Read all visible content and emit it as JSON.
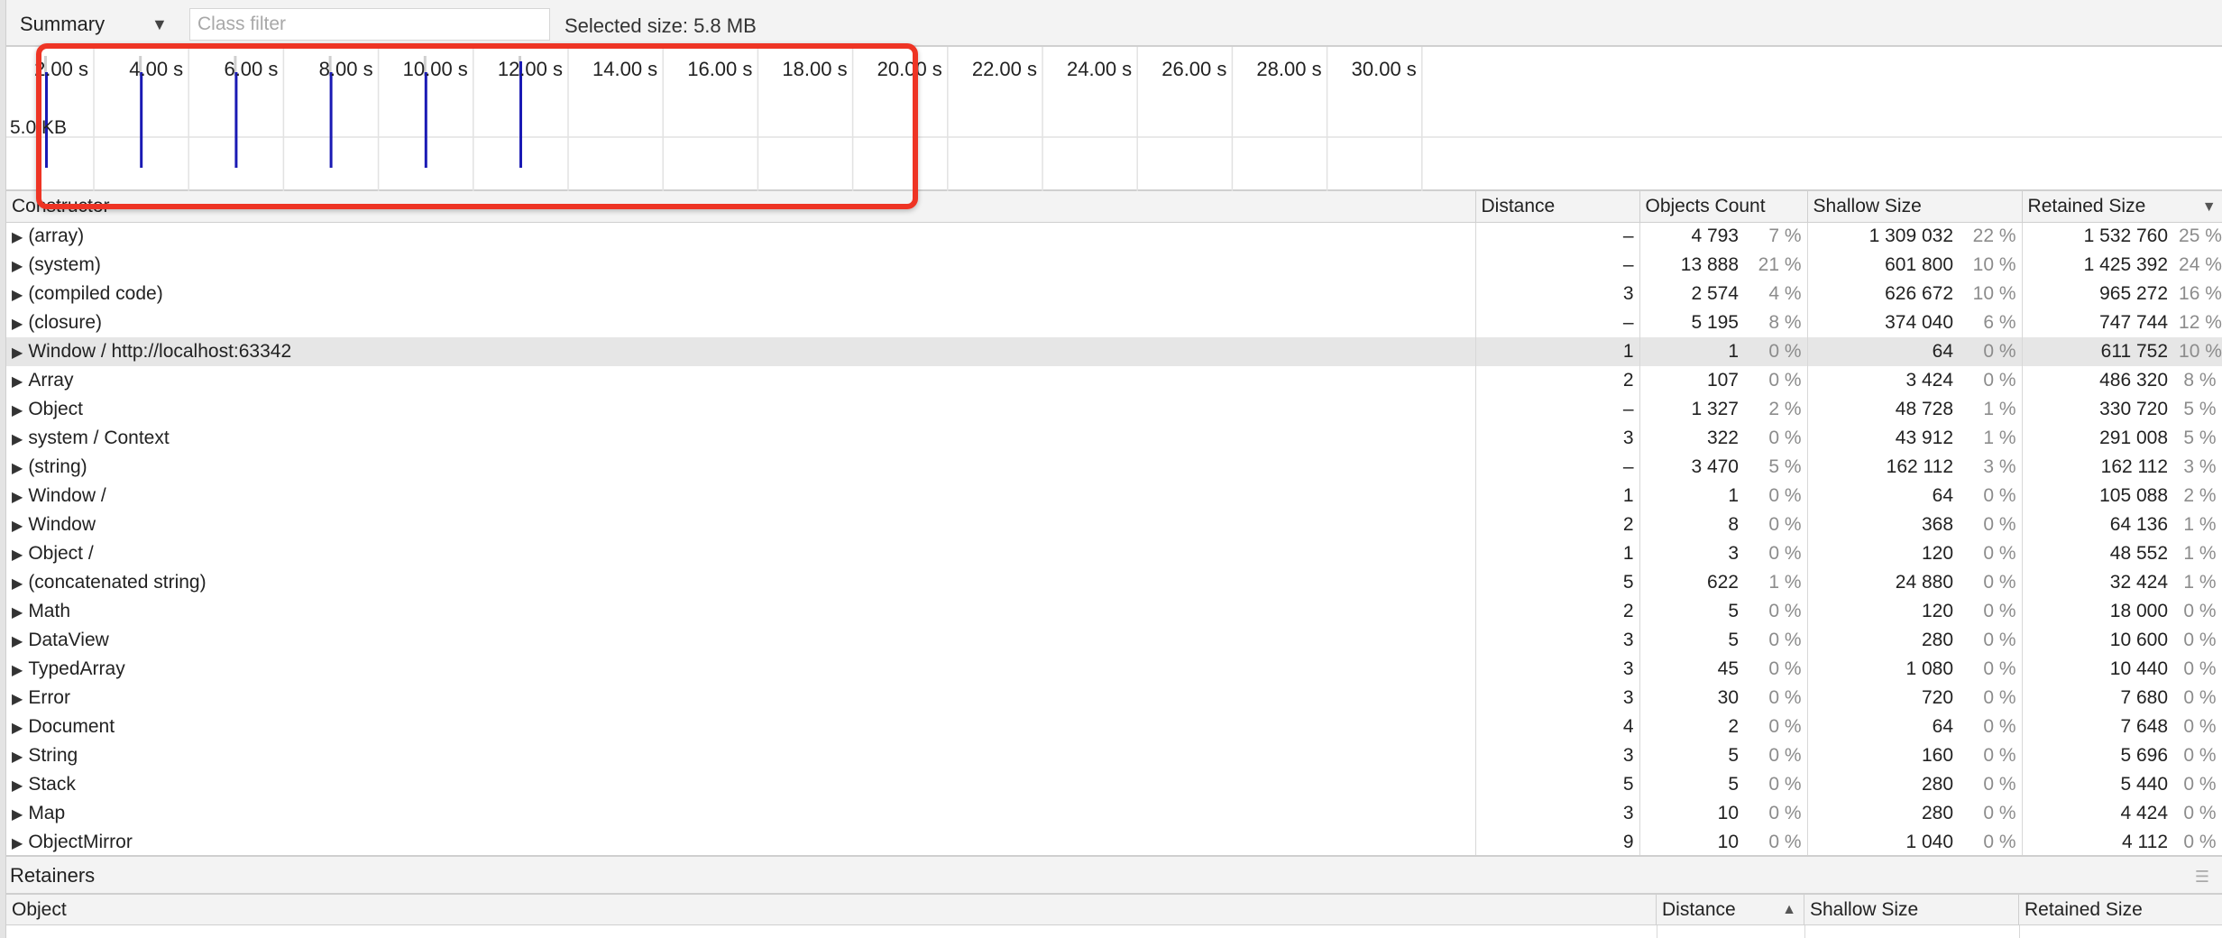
{
  "toolbar": {
    "view_select": "Summary",
    "class_filter_placeholder": "Class filter",
    "selected_size": "Selected size: 5.8 MB"
  },
  "timeline": {
    "ticks": [
      "2.00 s",
      "4.00 s",
      "6.00 s",
      "8.00 s",
      "10.00 s",
      "12.00 s",
      "14.00 s",
      "16.00 s",
      "18.00 s",
      "20.00 s",
      "22.00 s",
      "24.00 s",
      "26.00 s",
      "28.00 s",
      "30.00 s"
    ],
    "y_label": "5.0 KB",
    "bar_color": "#1a1ab4",
    "highlight_color": "#ee3424"
  },
  "table": {
    "headers": {
      "constructor": "Constructor",
      "distance": "Distance",
      "objects_count": "Objects Count",
      "shallow_size": "Shallow Size",
      "retained_size": "Retained Size"
    },
    "rows": [
      {
        "name": "(array)",
        "distance": "–",
        "count": "4 793",
        "count_pct": "7 %",
        "shallow": "1 309 032",
        "shallow_pct": "22 %",
        "retained": "1 532 760",
        "retained_pct": "25 %"
      },
      {
        "name": "(system)",
        "distance": "–",
        "count": "13 888",
        "count_pct": "21 %",
        "shallow": "601 800",
        "shallow_pct": "10 %",
        "retained": "1 425 392",
        "retained_pct": "24 %"
      },
      {
        "name": "(compiled code)",
        "distance": "3",
        "count": "2 574",
        "count_pct": "4 %",
        "shallow": "626 672",
        "shallow_pct": "10 %",
        "retained": "965 272",
        "retained_pct": "16 %"
      },
      {
        "name": "(closure)",
        "distance": "–",
        "count": "5 195",
        "count_pct": "8 %",
        "shallow": "374 040",
        "shallow_pct": "6 %",
        "retained": "747 744",
        "retained_pct": "12 %"
      },
      {
        "name": "Window / http://localhost:63342",
        "distance": "1",
        "count": "1",
        "count_pct": "0 %",
        "shallow": "64",
        "shallow_pct": "0 %",
        "retained": "611 752",
        "retained_pct": "10 %"
      },
      {
        "name": "Array",
        "distance": "2",
        "count": "107",
        "count_pct": "0 %",
        "shallow": "3 424",
        "shallow_pct": "0 %",
        "retained": "486 320",
        "retained_pct": "8 %"
      },
      {
        "name": "Object",
        "distance": "–",
        "count": "1 327",
        "count_pct": "2 %",
        "shallow": "48 728",
        "shallow_pct": "1 %",
        "retained": "330 720",
        "retained_pct": "5 %"
      },
      {
        "name": "system / Context",
        "distance": "3",
        "count": "322",
        "count_pct": "0 %",
        "shallow": "43 912",
        "shallow_pct": "1 %",
        "retained": "291 008",
        "retained_pct": "5 %"
      },
      {
        "name": "(string)",
        "distance": "–",
        "count": "3 470",
        "count_pct": "5 %",
        "shallow": "162 112",
        "shallow_pct": "3 %",
        "retained": "162 112",
        "retained_pct": "3 %"
      },
      {
        "name": "Window /",
        "distance": "1",
        "count": "1",
        "count_pct": "0 %",
        "shallow": "64",
        "shallow_pct": "0 %",
        "retained": "105 088",
        "retained_pct": "2 %"
      },
      {
        "name": "Window",
        "distance": "2",
        "count": "8",
        "count_pct": "0 %",
        "shallow": "368",
        "shallow_pct": "0 %",
        "retained": "64 136",
        "retained_pct": "1 %"
      },
      {
        "name": "Object /",
        "distance": "1",
        "count": "3",
        "count_pct": "0 %",
        "shallow": "120",
        "shallow_pct": "0 %",
        "retained": "48 552",
        "retained_pct": "1 %"
      },
      {
        "name": "(concatenated string)",
        "distance": "5",
        "count": "622",
        "count_pct": "1 %",
        "shallow": "24 880",
        "shallow_pct": "0 %",
        "retained": "32 424",
        "retained_pct": "1 %"
      },
      {
        "name": "Math",
        "distance": "2",
        "count": "5",
        "count_pct": "0 %",
        "shallow": "120",
        "shallow_pct": "0 %",
        "retained": "18 000",
        "retained_pct": "0 %"
      },
      {
        "name": "DataView",
        "distance": "3",
        "count": "5",
        "count_pct": "0 %",
        "shallow": "280",
        "shallow_pct": "0 %",
        "retained": "10 600",
        "retained_pct": "0 %"
      },
      {
        "name": "TypedArray",
        "distance": "3",
        "count": "45",
        "count_pct": "0 %",
        "shallow": "1 080",
        "shallow_pct": "0 %",
        "retained": "10 440",
        "retained_pct": "0 %"
      },
      {
        "name": "Error",
        "distance": "3",
        "count": "30",
        "count_pct": "0 %",
        "shallow": "720",
        "shallow_pct": "0 %",
        "retained": "7 680",
        "retained_pct": "0 %"
      },
      {
        "name": "Document",
        "distance": "4",
        "count": "2",
        "count_pct": "0 %",
        "shallow": "64",
        "shallow_pct": "0 %",
        "retained": "7 648",
        "retained_pct": "0 %"
      },
      {
        "name": "String",
        "distance": "3",
        "count": "5",
        "count_pct": "0 %",
        "shallow": "160",
        "shallow_pct": "0 %",
        "retained": "5 696",
        "retained_pct": "0 %"
      },
      {
        "name": "Stack",
        "distance": "5",
        "count": "5",
        "count_pct": "0 %",
        "shallow": "280",
        "shallow_pct": "0 %",
        "retained": "5 440",
        "retained_pct": "0 %"
      },
      {
        "name": "Map",
        "distance": "3",
        "count": "10",
        "count_pct": "0 %",
        "shallow": "280",
        "shallow_pct": "0 %",
        "retained": "4 424",
        "retained_pct": "0 %"
      },
      {
        "name": "ObjectMirror",
        "distance": "9",
        "count": "10",
        "count_pct": "0 %",
        "shallow": "1 040",
        "shallow_pct": "0 %",
        "retained": "4 112",
        "retained_pct": "0 %"
      }
    ],
    "selected_row_index": 4
  },
  "retainers": {
    "title": "Retainers",
    "headers": {
      "object": "Object",
      "distance": "Distance",
      "shallow_size": "Shallow Size",
      "retained_size": "Retained Size"
    }
  }
}
